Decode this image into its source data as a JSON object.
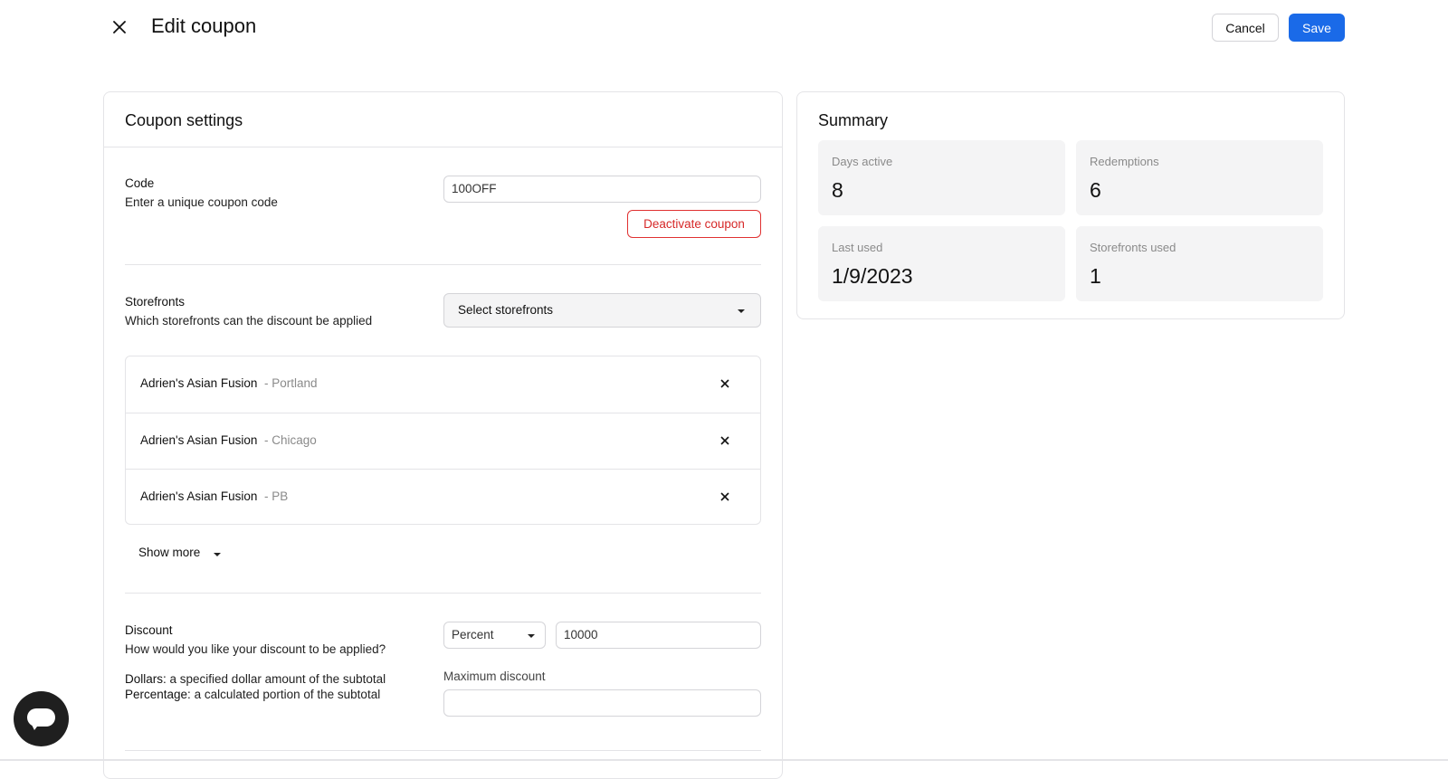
{
  "header": {
    "title": "Edit coupon",
    "cancel_label": "Cancel",
    "save_label": "Save",
    "close_icon": "close-icon"
  },
  "coupon_settings": {
    "title": "Coupon settings",
    "code": {
      "label": "Code",
      "description": "Enter a unique coupon code",
      "value": "100OFF",
      "deactivate_label": "Deactivate coupon"
    },
    "storefronts": {
      "label": "Storefronts",
      "description": "Which storefronts can the discount be applied",
      "select_placeholder": "Select storefronts",
      "items": [
        {
          "name": "Adrien's Asian Fusion",
          "location": "- Portland"
        },
        {
          "name": "Adrien's Asian Fusion",
          "location": "- Chicago"
        },
        {
          "name": "Adrien's Asian Fusion",
          "location": "- PB"
        }
      ],
      "show_more_label": "Show more"
    },
    "discount": {
      "label": "Discount",
      "description": "How would you like your discount to be applied?",
      "dollars_term": "Dollars:",
      "dollars_text": " a specified dollar amount of the subtotal",
      "percentage_term": "Percentage:",
      "percentage_text": " a calculated portion of the subtotal",
      "type_value": "Percent",
      "amount_value": "10000",
      "max_discount_label": "Maximum discount",
      "max_discount_value": ""
    }
  },
  "summary": {
    "title": "Summary",
    "stats": [
      {
        "label": "Days active",
        "value": "8"
      },
      {
        "label": "Redemptions",
        "value": "6"
      },
      {
        "label": "Last used",
        "value": "1/9/2023"
      },
      {
        "label": "Storefronts used",
        "value": "1"
      }
    ]
  },
  "colors": {
    "accent": "#1a6ae8",
    "danger": "#d62828",
    "fab": "#1f1f1f"
  },
  "chat_icon": "chat-icon"
}
